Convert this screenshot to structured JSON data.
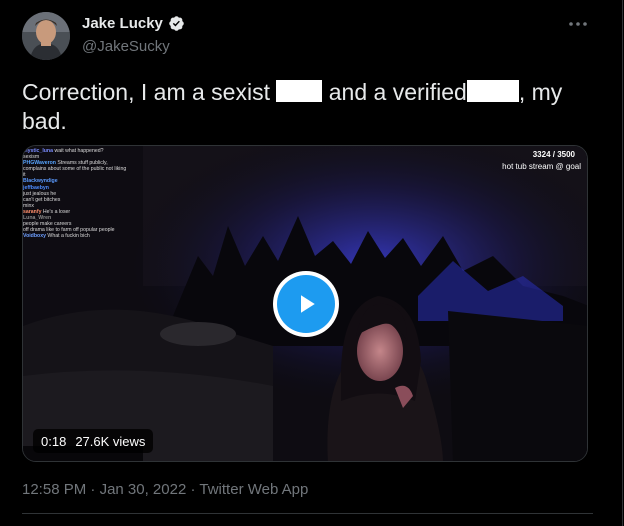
{
  "author": {
    "name": "Jake Lucky",
    "handle": "@JakeSucky",
    "avatar_icon": "avatar-photo",
    "verified_icon": "verified-badge-icon"
  },
  "tweet": {
    "text_1": "Correction, I am a sexist",
    "text_2": "and a verified",
    "text_3": ", my bad."
  },
  "video": {
    "counter": "3324 / 3500",
    "goal_text": "hot tub stream @ goal",
    "time": "0:18",
    "views": "27.6K views",
    "chat": [
      {
        "user": "mystic_luna",
        "color": "#7a8cff",
        "msg": "wait what happened?"
      },
      {
        "user": "",
        "color": "#c04dff",
        "msg": "sexism"
      },
      {
        "user": "PHGWaveron",
        "color": "#58a6ff",
        "msg": "Streams stuff publicly,"
      },
      {
        "user": "",
        "color": "#dcdcdc",
        "msg": "complains about some of the public not liking"
      },
      {
        "user": "",
        "color": "#dcdcdc",
        "msg": "it"
      },
      {
        "user": "Blackwyndige",
        "color": "#5b9bff",
        "msg": ""
      },
      {
        "user": "jeffbaebyn",
        "color": "#4d8cff",
        "msg": ""
      },
      {
        "user": "",
        "color": "#e0484f",
        "msg": "just jealous he"
      },
      {
        "user": "",
        "color": "#dcdcdc",
        "msg": "can't get bitches"
      },
      {
        "user": "",
        "color": "#3fa7ff",
        "msg": "minx"
      },
      {
        "user": "saranfy",
        "color": "#ff8f6b",
        "msg": "He's a loser"
      },
      {
        "user": "",
        "color": "#b04dff",
        "msg": ""
      },
      {
        "user": "",
        "color": "#e0484f",
        "msg": ""
      },
      {
        "user": "Luna_Wren",
        "color": "#8a8a8a",
        "msg": ""
      },
      {
        "user": "",
        "color": "#58a6ff",
        "msg": "people make careers"
      },
      {
        "user": "",
        "color": "#dcdcdc",
        "msg": "off drama like to farm off popular people"
      },
      {
        "user": "Voidboxy",
        "color": "#6fa0ff",
        "msg": "What a fuckin bich"
      }
    ]
  },
  "meta": {
    "time": "12:58 PM",
    "sep": "·",
    "date": "Jan 30, 2022",
    "source": "Twitter Web App"
  },
  "colors": {
    "background": "#000000",
    "accent": "#1d9bf0",
    "secondary_text": "#71767b",
    "border": "#2f3336"
  }
}
